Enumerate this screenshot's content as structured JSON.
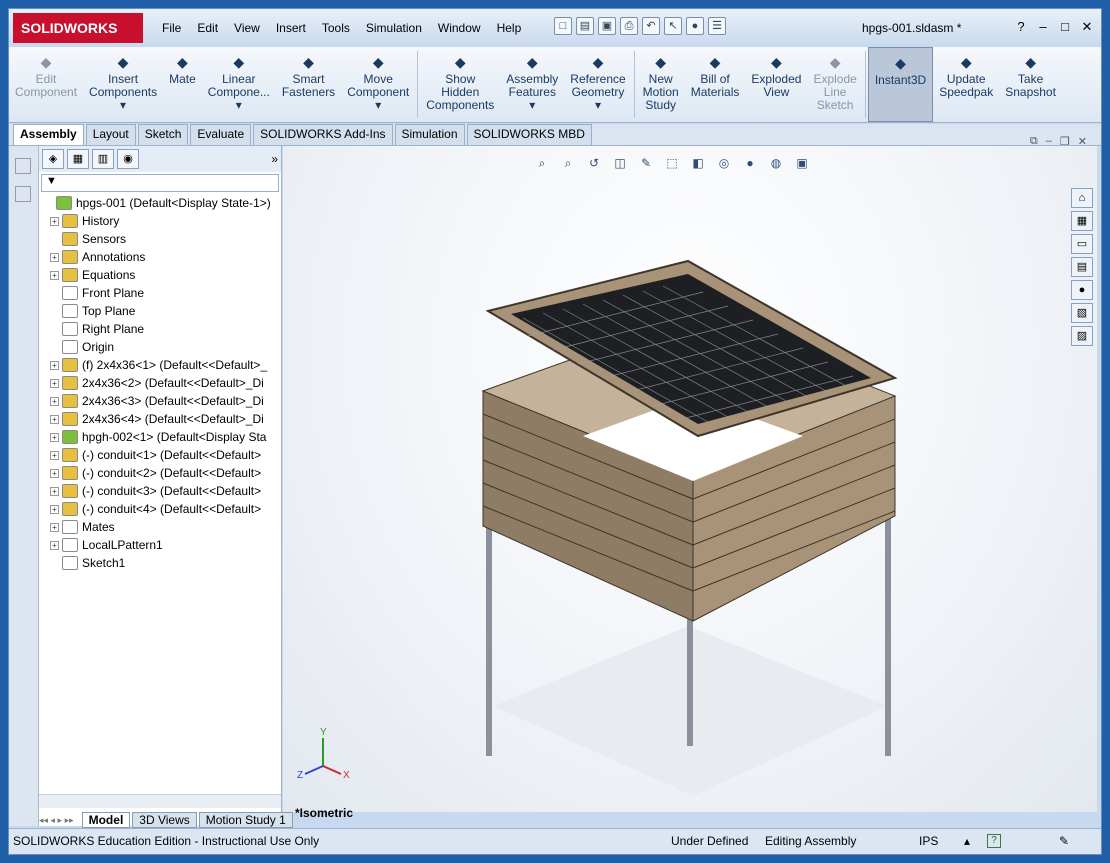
{
  "app": {
    "logo_text": "SOLIDWORKS",
    "doc_title": "hpgs-001.sldasm *"
  },
  "menu": [
    "File",
    "Edit",
    "View",
    "Insert",
    "Tools",
    "Simulation",
    "Window",
    "Help"
  ],
  "ribbon": [
    {
      "l1": "Edit",
      "l2": "Component",
      "l3": "",
      "icon": "edit-component-icon",
      "dis": true
    },
    {
      "l1": "Insert",
      "l2": "Components",
      "l3": "▾",
      "icon": "insert-components-icon"
    },
    {
      "l1": "Mate",
      "l2": "",
      "l3": "",
      "icon": "mate-icon"
    },
    {
      "l1": "Linear",
      "l2": "Compone...",
      "l3": "▾",
      "icon": "linear-pattern-icon"
    },
    {
      "l1": "Smart",
      "l2": "Fasteners",
      "l3": "",
      "icon": "smart-fasteners-icon"
    },
    {
      "l1": "Move",
      "l2": "Component",
      "l3": "▾",
      "icon": "move-component-icon"
    },
    {
      "l1": "Show",
      "l2": "Hidden",
      "l3": "Components",
      "icon": "show-hidden-icon"
    },
    {
      "l1": "Assembly",
      "l2": "Features",
      "l3": "▾",
      "icon": "assembly-features-icon"
    },
    {
      "l1": "Reference",
      "l2": "Geometry",
      "l3": "▾",
      "icon": "reference-geometry-icon"
    },
    {
      "l1": "New",
      "l2": "Motion",
      "l3": "Study",
      "icon": "motion-study-icon"
    },
    {
      "l1": "Bill of",
      "l2": "Materials",
      "l3": "",
      "icon": "bom-icon"
    },
    {
      "l1": "Exploded",
      "l2": "View",
      "l3": "",
      "icon": "exploded-view-icon"
    },
    {
      "l1": "Explode",
      "l2": "Line",
      "l3": "Sketch",
      "icon": "explode-line-icon",
      "dis": true
    },
    {
      "l1": "Instant3D",
      "l2": "",
      "l3": "",
      "icon": "instant3d-icon",
      "active": true
    },
    {
      "l1": "Update",
      "l2": "Speedpak",
      "l3": "",
      "icon": "speedpak-icon"
    },
    {
      "l1": "Take",
      "l2": "Snapshot",
      "l3": "",
      "icon": "snapshot-icon"
    }
  ],
  "tabs": [
    "Assembly",
    "Layout",
    "Sketch",
    "Evaluate",
    "SOLIDWORKS Add-Ins",
    "Simulation",
    "SOLIDWORKS MBD"
  ],
  "tree": [
    {
      "t": "hpgs-001  (Default<Display State-1>)",
      "exp": false,
      "c": "#7cbf3a"
    },
    {
      "t": "History",
      "exp": true,
      "c": "#e8c040"
    },
    {
      "t": "Sensors",
      "exp": false,
      "c": "#e8c040"
    },
    {
      "t": "Annotations",
      "exp": true,
      "c": "#e8c040"
    },
    {
      "t": "Equations",
      "exp": true,
      "c": "#e8c040"
    },
    {
      "t": "Front Plane",
      "exp": false,
      "c": "#fff"
    },
    {
      "t": "Top Plane",
      "exp": false,
      "c": "#fff"
    },
    {
      "t": "Right Plane",
      "exp": false,
      "c": "#fff"
    },
    {
      "t": "Origin",
      "exp": false,
      "c": "#fff"
    },
    {
      "t": "(f) 2x4x36<1> (Default<<Default>_",
      "exp": true,
      "c": "#e8c040"
    },
    {
      "t": "2x4x36<2> (Default<<Default>_Di",
      "exp": true,
      "c": "#e8c040"
    },
    {
      "t": "2x4x36<3> (Default<<Default>_Di",
      "exp": true,
      "c": "#e8c040"
    },
    {
      "t": "2x4x36<4> (Default<<Default>_Di",
      "exp": true,
      "c": "#e8c040"
    },
    {
      "t": "hpgh-002<1> (Default<Display Sta",
      "exp": true,
      "c": "#7cbf3a"
    },
    {
      "t": "(-) conduit<1> (Default<<Default>",
      "exp": true,
      "c": "#e8c040"
    },
    {
      "t": "(-) conduit<2> (Default<<Default>",
      "exp": true,
      "c": "#e8c040"
    },
    {
      "t": "(-) conduit<3> (Default<<Default>",
      "exp": true,
      "c": "#e8c040"
    },
    {
      "t": "(-) conduit<4> (Default<<Default>",
      "exp": true,
      "c": "#e8c040"
    },
    {
      "t": "Mates",
      "exp": true,
      "c": "#fff"
    },
    {
      "t": "LocalLPattern1",
      "exp": true,
      "c": "#fff"
    },
    {
      "t": "Sketch1",
      "exp": false,
      "c": "#fff"
    }
  ],
  "bottom_tabs": [
    "Model",
    "3D Views",
    "Motion Study 1"
  ],
  "view_name": "*Isometric",
  "status": {
    "edition": "SOLIDWORKS Education Edition - Instructional Use Only",
    "state": "Under Defined",
    "mode": "Editing Assembly",
    "units": "IPS"
  }
}
